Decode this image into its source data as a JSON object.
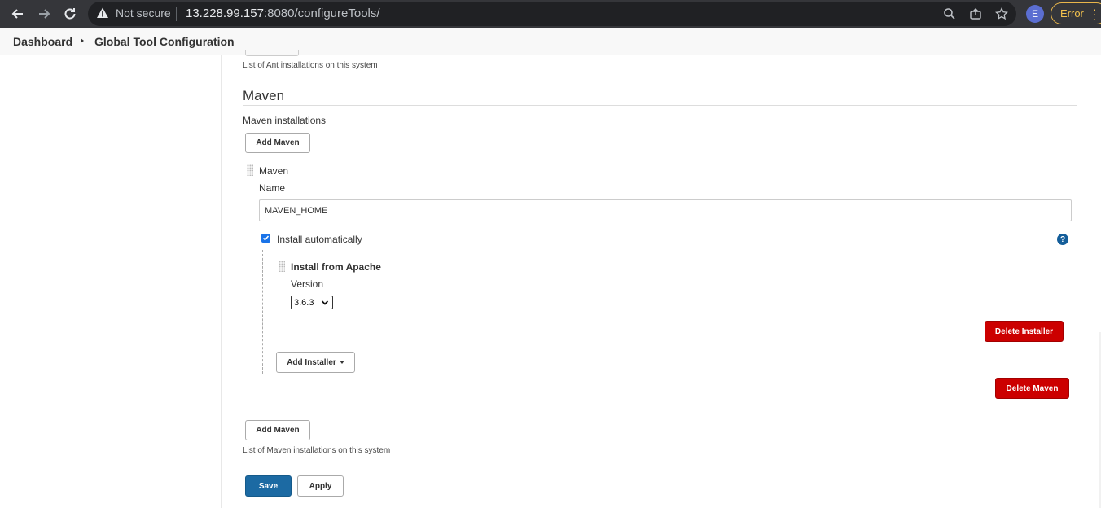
{
  "browser": {
    "security_label": "Not secure",
    "url_host": "13.228.99.157",
    "url_rest": ":8080/configureTools/",
    "profile_initial": "E",
    "error_label": "Error"
  },
  "breadcrumb": {
    "items": [
      "Dashboard",
      "Global Tool Configuration"
    ]
  },
  "ant": {
    "help": "List of Ant installations on this system"
  },
  "maven": {
    "section_title": "Maven",
    "installations_label": "Maven installations",
    "add_button_top": "Add Maven",
    "entry": {
      "header": "Maven",
      "name_label": "Name",
      "name_value": "MAVEN_HOME",
      "install_auto_label": "Install automatically",
      "install_auto_checked": true,
      "installer": {
        "title": "Install from Apache",
        "version_label": "Version",
        "version_value": "3.6.3",
        "delete_button": "Delete Installer"
      },
      "add_installer_button": "Add Installer",
      "delete_button": "Delete Maven"
    },
    "add_button_bottom": "Add Maven",
    "help": "List of Maven installations on this system"
  },
  "actions": {
    "save": "Save",
    "apply": "Apply"
  },
  "colors": {
    "danger": "#cc0000",
    "primary": "#1c6aa3",
    "checkbox": "#1a73e8"
  }
}
